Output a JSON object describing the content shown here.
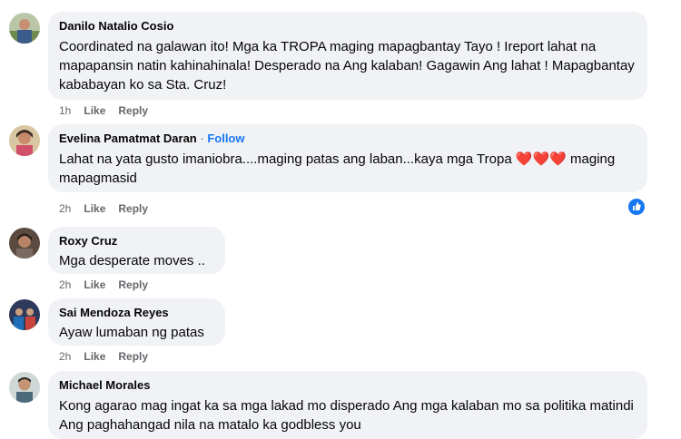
{
  "comments": [
    {
      "author": "Danilo Natalio Cosio",
      "text": "Coordinated na galawan ito! Mga ka TROPA maging mapagbantay Tayo ! Ireport lahat na mapapansin natin kahinahinala! Desperado na Ang kalaban! Gagawin Ang lahat ! Mapagbantay kababayan ko sa Sta. Cruz!",
      "time": "1h",
      "like": "Like",
      "reply": "Reply"
    },
    {
      "author": "Evelina Pamatmat Daran",
      "separator": "·",
      "follow": "Follow",
      "text": "Lahat na yata gusto imaniobra....maging patas ang laban...kaya mga Tropa ❤️❤️❤️ maging mapagmasid",
      "time": "2h",
      "like": "Like",
      "reply": "Reply",
      "reaction": "like-reaction-icon"
    },
    {
      "author": "Roxy Cruz",
      "text": "Mga desperate moves ..",
      "time": "2h",
      "like": "Like",
      "reply": "Reply"
    },
    {
      "author": "Sai Mendoza Reyes",
      "text": "Ayaw lumaban ng patas",
      "time": "2h",
      "like": "Like",
      "reply": "Reply"
    },
    {
      "author": "Michael Morales",
      "text": "Kong agarao mag ingat ka sa mga lakad mo disperado Ang mga kalaban mo sa politika matindi Ang paghahangad nila na matalo ka godbless you"
    }
  ],
  "colors": {
    "bubble": "#f0f2f5",
    "link": "#1877f2",
    "meta": "#65676b"
  }
}
